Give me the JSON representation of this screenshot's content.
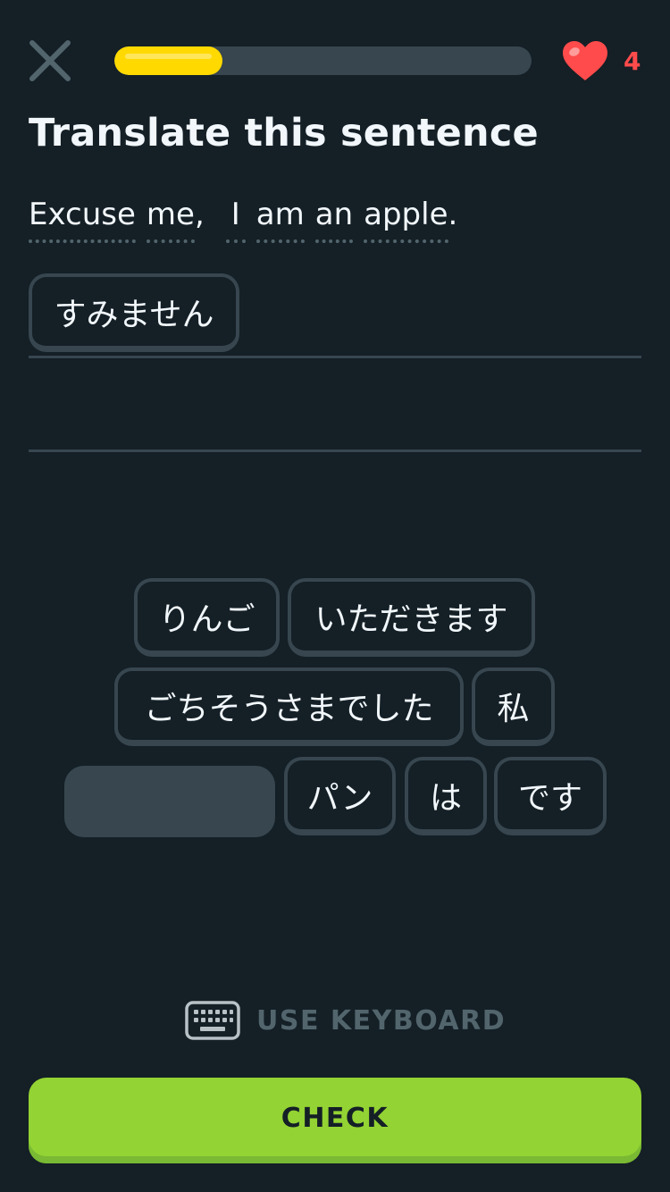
{
  "header": {
    "close_icon": "close-icon",
    "progress": 0.26,
    "progress_color": "#ffd900",
    "hearts_icon": "heart-icon",
    "hearts_count": "4",
    "hearts_color": "#ff4b4b"
  },
  "title": "Translate this sentence",
  "prompt": {
    "words": [
      "Excuse",
      "me",
      "I",
      "am",
      "an",
      "apple"
    ]
  },
  "answer": {
    "selected_tiles": [
      "すみません"
    ]
  },
  "word_bank": {
    "rows": [
      [
        "りんご",
        "いただきます"
      ],
      [
        "ごちそうさまでした",
        "私"
      ],
      [
        "パン",
        "は",
        "です"
      ]
    ]
  },
  "keyboard_toggle": {
    "icon": "keyboard-icon",
    "label": "USE KEYBOARD"
  },
  "check_button": {
    "label": "CHECK",
    "color": "#93d333"
  }
}
